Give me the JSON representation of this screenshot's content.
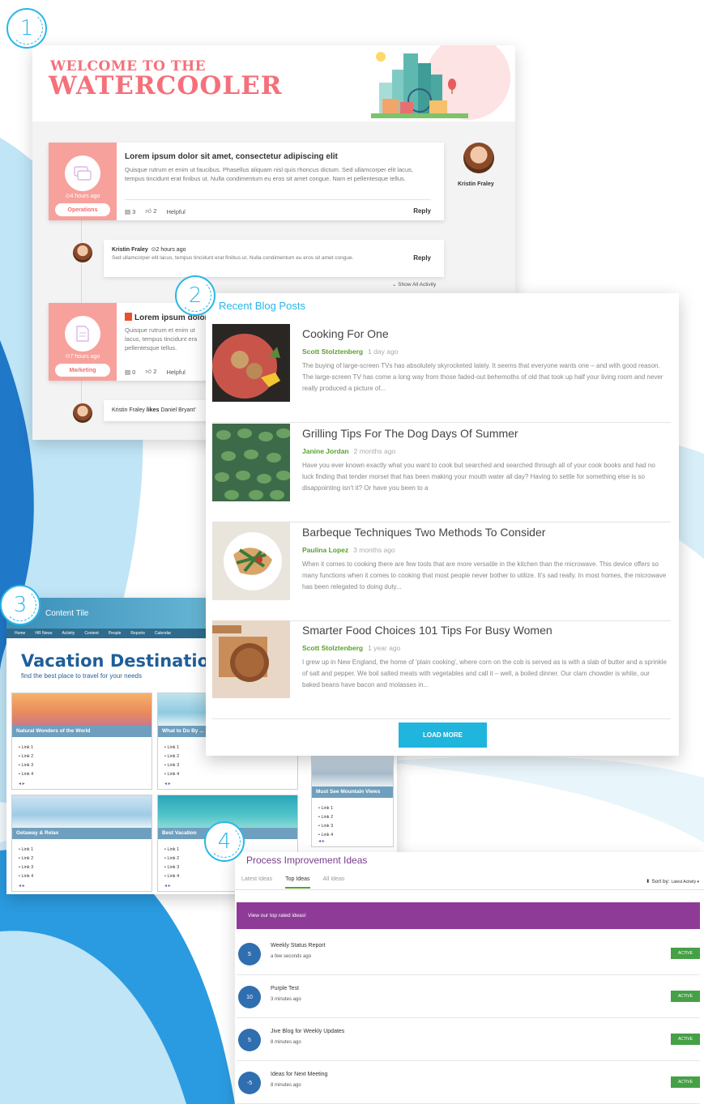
{
  "badges": [
    "1",
    "2",
    "3",
    "4"
  ],
  "colors": {
    "accent": "#29b6e6",
    "coral": "#f5707a",
    "purple": "#8e3b97",
    "green": "#46a046",
    "blue": "#2f6fb0"
  },
  "watercooler": {
    "title_small": "WELCOME TO THE",
    "title_big": "WATERCOOLER",
    "post1": {
      "time": "⊙4 hours ago",
      "tag": "Operations",
      "title": "Lorem ipsum dolor sit amet, consectetur adipiscing elit",
      "body": "Quisque rutrum et enim ut faucibus. Phasellus aliquam nisl quis rhoncus dictum. Sed ullamcorper elit lacus, tempus tincidunt erat finibus ut. Nulla condimentum eu eros sit amet congue. Nam et pellentesque tellus.",
      "comments": "3",
      "likes": "2",
      "helpful": "Helpful",
      "reply": "Reply",
      "author": "Kristin Fraley"
    },
    "comment1": {
      "name": "Kristin Fraley",
      "time": "⊙2 hours ago",
      "text": "Sed ullamcorper elit lacus, tempus tincidunt erat finibus ut. Nulla condimentum eu eros sit amet congue.",
      "reply": "Reply"
    },
    "show_all": "Show All Activity",
    "post2": {
      "time": "⊙7 hours ago",
      "tag": "Marketing",
      "title": "Lorem ipsum dolor",
      "body": "Quisque rutrum et enim ut lacus, tempus tincidunt era pellentesque tellus.",
      "comments": "0",
      "likes": "2",
      "helpful": "Helpful"
    },
    "activity": {
      "name": "Kristin Fraley",
      "verb": "likes",
      "rest": "Daniel Bryant'"
    }
  },
  "blog": {
    "heading": "Recent Blog Posts",
    "posts": [
      {
        "title": "Cooking For One",
        "author": "Scott Stolztenberg",
        "age": "1 day ago",
        "excerpt": "The buying of large-screen TVs has absolutely skyrocketed lately. It seems that everyone wants one – and with good reason. The large-screen TV has come a long way from those faded-out behemoths of old that took up half your living room and never really produced a picture of..."
      },
      {
        "title": "Grilling Tips For The Dog Days Of Summer",
        "author": "Janine Jordan",
        "age": "2 months ago",
        "excerpt": "Have you ever known exactly what you want to cook but searched and searched through all of your cook books and had no luck finding that tender morsel that has been making your mouth water all day? Having to settle for something else is so disappointing isn't it? Or have you been to a"
      },
      {
        "title": "Barbeque Techniques Two Methods To Consider",
        "author": "Paulina Lopez",
        "age": "3 months ago",
        "excerpt": "When it comes to cooking there are few tools that are more versatile in the kitchen than the microwave. This device offers so many functions when it comes to cooking that most people never bother to utilize. It's sad really. In most homes, the microwave has been relegated to doing duty..."
      },
      {
        "title": "Smarter Food Choices 101 Tips For Busy Women",
        "author": "Scott Stolztenberg",
        "age": "1 year ago",
        "excerpt": "I grew up in New England, the home of 'plain cooking', where corn on the cob is served as is with a slab of butter and a sprinkle of salt and pepper. We boil salted meats with vegetables and call it – well, a boiled dinner. Our clam chowder is white, our baked beans have bacon and molasses in..."
      }
    ],
    "load_more": "LOAD MORE"
  },
  "vacation": {
    "content_tile": "Content Tile",
    "nav": [
      "Home",
      "HR News",
      "Activity",
      "Content",
      "People",
      "Reports",
      "Calendar"
    ],
    "title": "Vacation Destinations",
    "subtitle": "find the best place to travel for your needs",
    "tiles": [
      {
        "caption": "Natural Wonders of the World",
        "links": [
          "Link 1",
          "Link 2",
          "Link 3",
          "Link 4"
        ]
      },
      {
        "caption": "What to Do By ...",
        "links": [
          "Link 1",
          "Link 2",
          "Link 3",
          "Link 4"
        ]
      },
      {
        "caption": "Must See Mountain Views",
        "links": [
          "Link 1",
          "Link 2",
          "Link 3",
          "Link 4"
        ]
      },
      {
        "caption": "Getaway & Relax",
        "links": [
          "Link 1",
          "Link 2",
          "Link 3",
          "Link 4"
        ]
      },
      {
        "caption": "Best Vacation",
        "links": [
          "Link 1",
          "Link 2",
          "Link 3",
          "Link 4"
        ]
      }
    ],
    "arrows": "◂ ▸"
  },
  "ideas": {
    "heading": "Process Improvement Ideas",
    "tabs": [
      "Latest Ideas",
      "Top Ideas",
      "All Ideas"
    ],
    "sort_label": "Sort by:",
    "sort_value": "Latest Activity ▾",
    "promo": "View our top rated ideas!",
    "items": [
      {
        "score": "5",
        "title": "Weekly Status Report",
        "age": "a few seconds ago",
        "status": "ACTIVE"
      },
      {
        "score": "10",
        "title": "Purple Test",
        "age": "3 minutes ago",
        "status": "ACTIVE"
      },
      {
        "score": "5",
        "title": "Jive Blog for Weekly Updates",
        "age": "8 minutes ago",
        "status": "ACTIVE"
      },
      {
        "score": "-5",
        "title": "Ideas for Next Meeting",
        "age": "8 minutes ago",
        "status": "ACTIVE"
      }
    ]
  }
}
